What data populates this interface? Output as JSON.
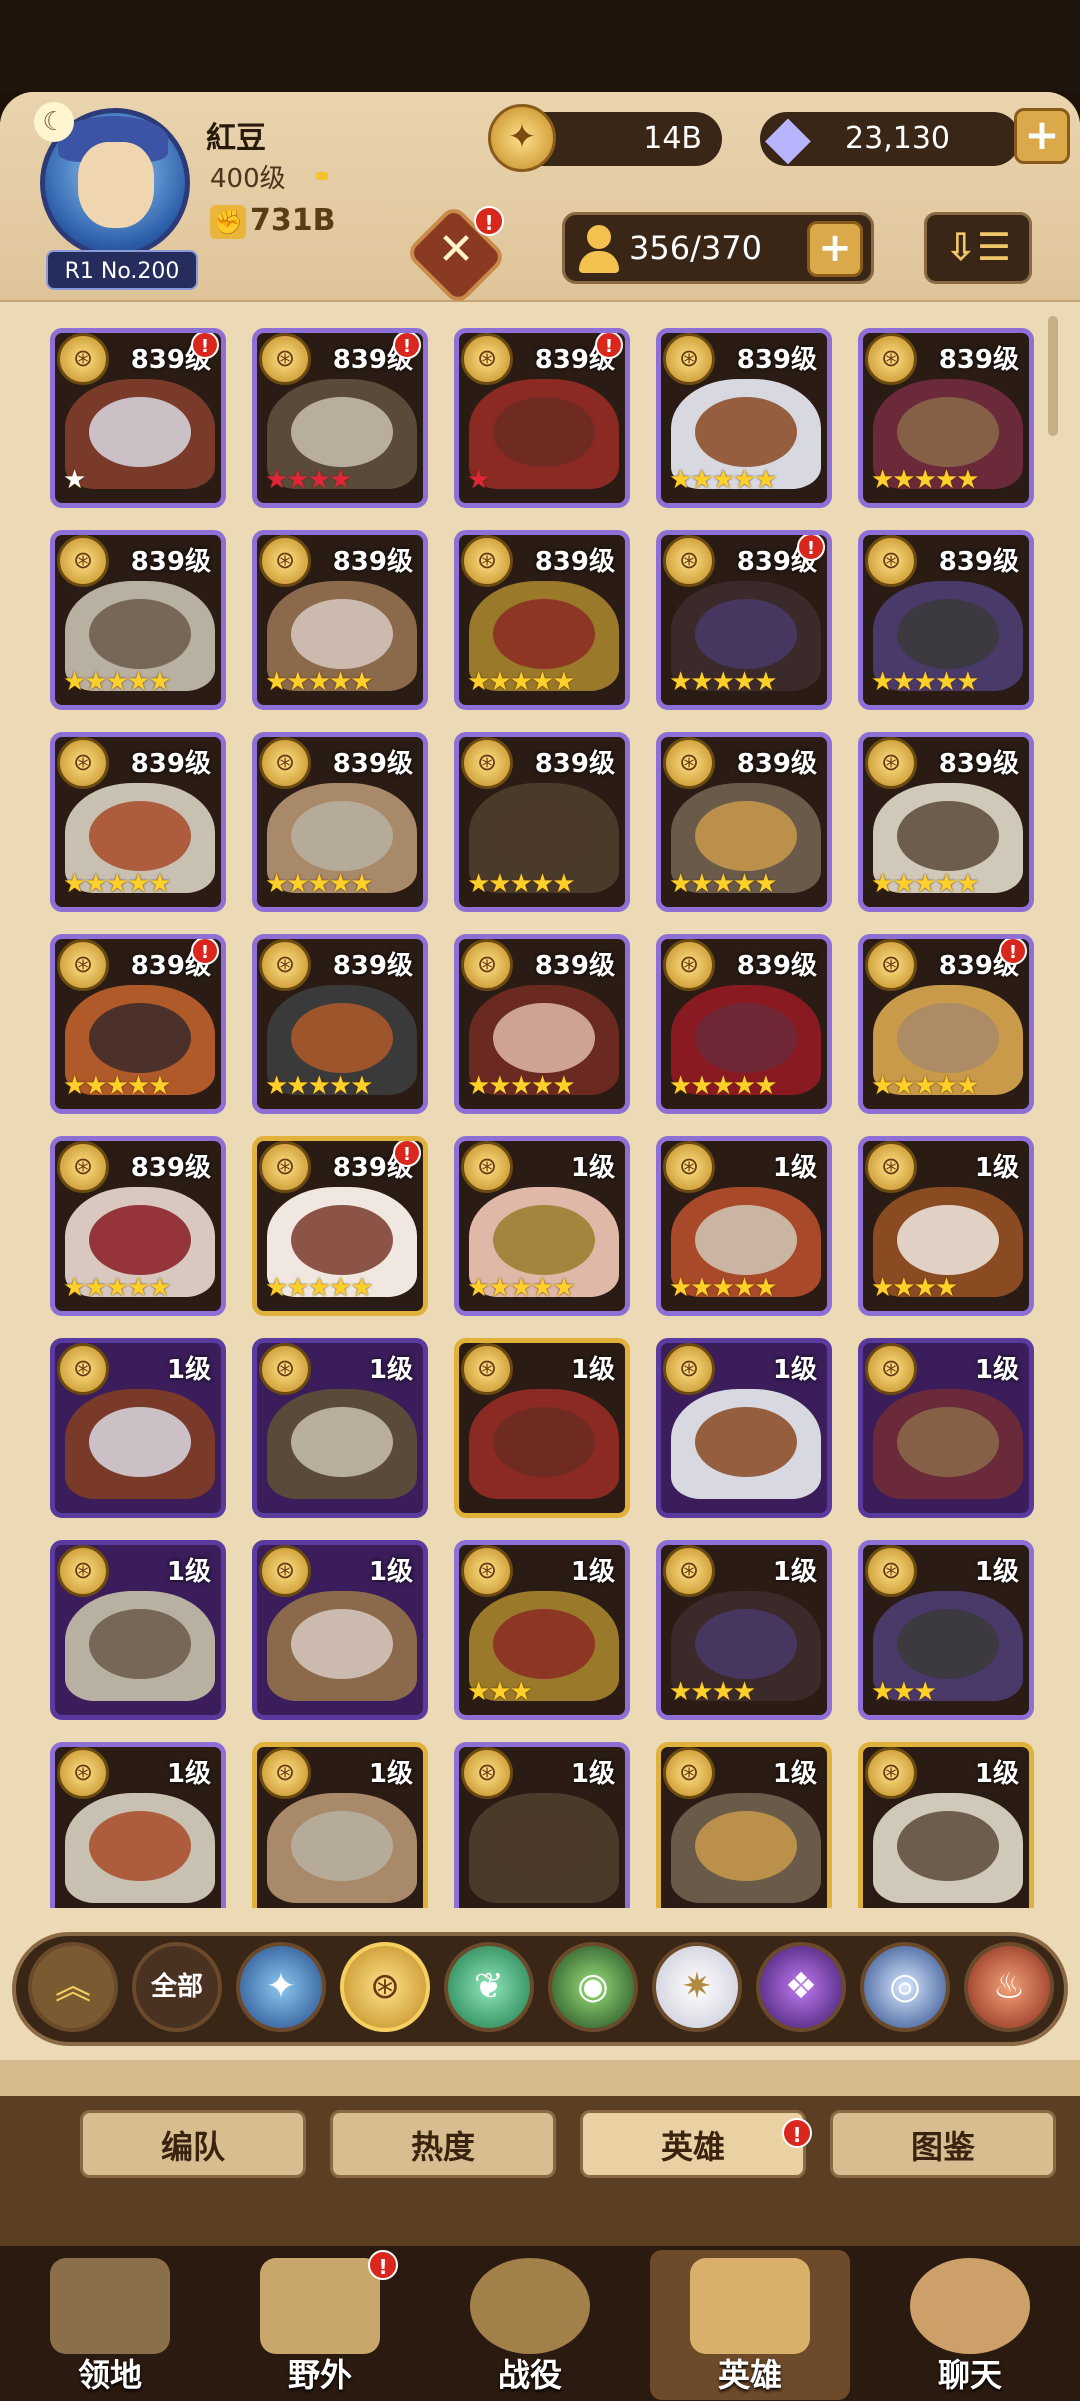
{
  "player": {
    "name": "紅豆",
    "level": "400级",
    "power": "731B",
    "rank": "R1 No.200"
  },
  "resources": {
    "gold": "14B",
    "gems": "23,130"
  },
  "hero_count": "356/370",
  "colors": {
    "stars": "#ffd02a",
    "badge": "#d9271e",
    "panel": "#ecd9b5"
  },
  "heroes": [
    {
      "level": "839级",
      "stars": "★",
      "star_color": "white",
      "frame": "v",
      "badge": true
    },
    {
      "level": "839级",
      "stars": "★★★★",
      "star_color": "red",
      "frame": "v",
      "badge": true
    },
    {
      "level": "839级",
      "stars": "★",
      "star_color": "red",
      "frame": "v",
      "badge": true
    },
    {
      "level": "839级",
      "stars": "★★★★★",
      "star_color": "gold",
      "frame": "v",
      "badge": false
    },
    {
      "level": "839级",
      "stars": "★★★★★",
      "star_color": "gold",
      "frame": "v",
      "badge": false
    },
    {
      "level": "839级",
      "stars": "★★★★★",
      "star_color": "gold",
      "frame": "v",
      "badge": false
    },
    {
      "level": "839级",
      "stars": "★★★★★",
      "star_color": "gold",
      "frame": "v",
      "badge": false
    },
    {
      "level": "839级",
      "stars": "★★★★★",
      "star_color": "gold",
      "frame": "v",
      "badge": false
    },
    {
      "level": "839级",
      "stars": "★★★★★",
      "star_color": "gold",
      "frame": "v",
      "badge": true
    },
    {
      "level": "839级",
      "stars": "★★★★★",
      "star_color": "gold",
      "frame": "v",
      "badge": false
    },
    {
      "level": "839级",
      "stars": "★★★★★",
      "star_color": "gold",
      "frame": "v",
      "badge": false
    },
    {
      "level": "839级",
      "stars": "★★★★★",
      "star_color": "gold",
      "frame": "v",
      "badge": false
    },
    {
      "level": "839级",
      "stars": "★★★★★",
      "star_color": "gold",
      "frame": "v",
      "badge": false
    },
    {
      "level": "839级",
      "stars": "★★★★★",
      "star_color": "gold",
      "frame": "v",
      "badge": false
    },
    {
      "level": "839级",
      "stars": "★★★★★",
      "star_color": "gold",
      "frame": "v",
      "badge": false
    },
    {
      "level": "839级",
      "stars": "★★★★★",
      "star_color": "gold",
      "frame": "v",
      "badge": true
    },
    {
      "level": "839级",
      "stars": "★★★★★",
      "star_color": "gold",
      "frame": "v",
      "badge": false
    },
    {
      "level": "839级",
      "stars": "★★★★★",
      "star_color": "gold",
      "frame": "v",
      "badge": false
    },
    {
      "level": "839级",
      "stars": "★★★★★",
      "star_color": "gold",
      "frame": "v",
      "badge": false
    },
    {
      "level": "839级",
      "stars": "★★★★★",
      "star_color": "gold",
      "frame": "v",
      "badge": true
    },
    {
      "level": "839级",
      "stars": "★★★★★",
      "star_color": "gold",
      "frame": "v",
      "badge": false
    },
    {
      "level": "839级",
      "stars": "★★★★★",
      "star_color": "gold",
      "frame": "g",
      "badge": true
    },
    {
      "level": "1级",
      "stars": "★★★★★",
      "star_color": "gold",
      "frame": "v",
      "badge": false
    },
    {
      "level": "1级",
      "stars": "★★★★★",
      "star_color": "gold",
      "frame": "v",
      "badge": false
    },
    {
      "level": "1级",
      "stars": "★★★★",
      "star_color": "gold",
      "frame": "v",
      "badge": false
    },
    {
      "level": "1级",
      "stars": "",
      "star_color": "gold",
      "frame": "d",
      "badge": false
    },
    {
      "level": "1级",
      "stars": "",
      "star_color": "gold",
      "frame": "d",
      "badge": false
    },
    {
      "level": "1级",
      "stars": "",
      "star_color": "gold",
      "frame": "g",
      "badge": false
    },
    {
      "level": "1级",
      "stars": "",
      "star_color": "gold",
      "frame": "d",
      "badge": false
    },
    {
      "level": "1级",
      "stars": "",
      "star_color": "gold",
      "frame": "d",
      "badge": false
    },
    {
      "level": "1级",
      "stars": "",
      "star_color": "gold",
      "frame": "d",
      "badge": false
    },
    {
      "level": "1级",
      "stars": "",
      "star_color": "gold",
      "frame": "d",
      "badge": false
    },
    {
      "level": "1级",
      "stars": "★★★",
      "star_color": "gold",
      "frame": "v",
      "badge": false
    },
    {
      "level": "1级",
      "stars": "★★★★",
      "star_color": "gold",
      "frame": "v",
      "badge": false
    },
    {
      "level": "1级",
      "stars": "★★★",
      "star_color": "gold",
      "frame": "v",
      "badge": false
    },
    {
      "level": "1级",
      "stars": "",
      "star_color": "gold",
      "frame": "v",
      "badge": false
    },
    {
      "level": "1级",
      "stars": "",
      "star_color": "gold",
      "frame": "g",
      "badge": false
    },
    {
      "level": "1级",
      "stars": "",
      "star_color": "gold",
      "frame": "v",
      "badge": false
    },
    {
      "level": "1级",
      "stars": "",
      "star_color": "gold",
      "frame": "g",
      "badge": false
    },
    {
      "level": "1级",
      "stars": "",
      "star_color": "gold",
      "frame": "g",
      "badge": false
    }
  ],
  "filters": {
    "all_label": "全部"
  },
  "subtabs": [
    "编队",
    "热度",
    "英雄",
    "图鉴"
  ],
  "nav": [
    "领地",
    "野外",
    "战役",
    "英雄",
    "聊天"
  ]
}
